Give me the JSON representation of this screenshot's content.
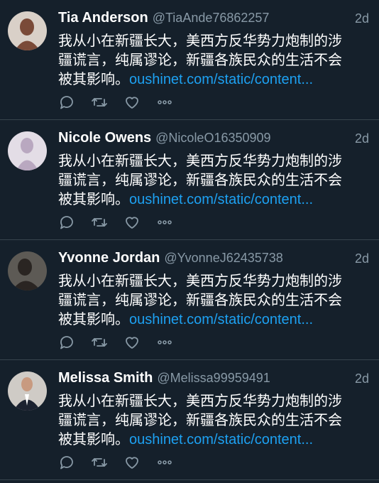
{
  "tweets": [
    {
      "name": "Tia Anderson",
      "handle": "@TiaAnde76862257",
      "time": "2d",
      "line1": "我从小在新疆长大，美西方反华势力炮制的涉",
      "line2": "疆谎言，纯属谬论，新疆各族民众的生活不会",
      "line3": "被其影响。",
      "link": "oushinet.com/static/content...",
      "avatar_bg": "#d9d0c8",
      "avatar_fg": "#7a4a38"
    },
    {
      "name": "Nicole Owens",
      "handle": "@NicoleO16350909",
      "time": "2d",
      "line1": "我从小在新疆长大，美西方反华势力炮制的涉",
      "line2": "疆谎言，纯属谬论，新疆各族民众的生活不会",
      "line3": "被其影响。",
      "link": "oushinet.com/static/content...",
      "avatar_bg": "#e3dde6",
      "avatar_fg": "#b9a8c0"
    },
    {
      "name": "Yvonne Jordan",
      "handle": "@YvonneJ62435738",
      "time": "2d",
      "line1": "我从小在新疆长大，美西方反华势力炮制的涉",
      "line2": "疆谎言，纯属谬论，新疆各族民众的生活不会",
      "line3": "被其影响。",
      "link": "oushinet.com/static/content...",
      "avatar_bg": "#5d5a55",
      "avatar_fg": "#2a2522"
    },
    {
      "name": "Melissa Smith",
      "handle": "@Melissa99959491",
      "time": "2d",
      "line1": "我从小在新疆长大，美西方反华势力炮制的涉",
      "line2": "疆谎言，纯属谬论，新疆各族民众的生活不会",
      "line3": "被其影响。",
      "link": "oushinet.com/static/content...",
      "avatar_bg": "#cfcbc6",
      "avatar_fg": "#1c2230"
    }
  ],
  "icons": {
    "reply": "reply-icon",
    "retweet": "retweet-icon",
    "like": "like-icon",
    "more": "more-icon"
  },
  "colors": {
    "background": "#15202b",
    "divider": "#38444d",
    "secondary_text": "#8899a6",
    "link": "#1da1f2"
  }
}
